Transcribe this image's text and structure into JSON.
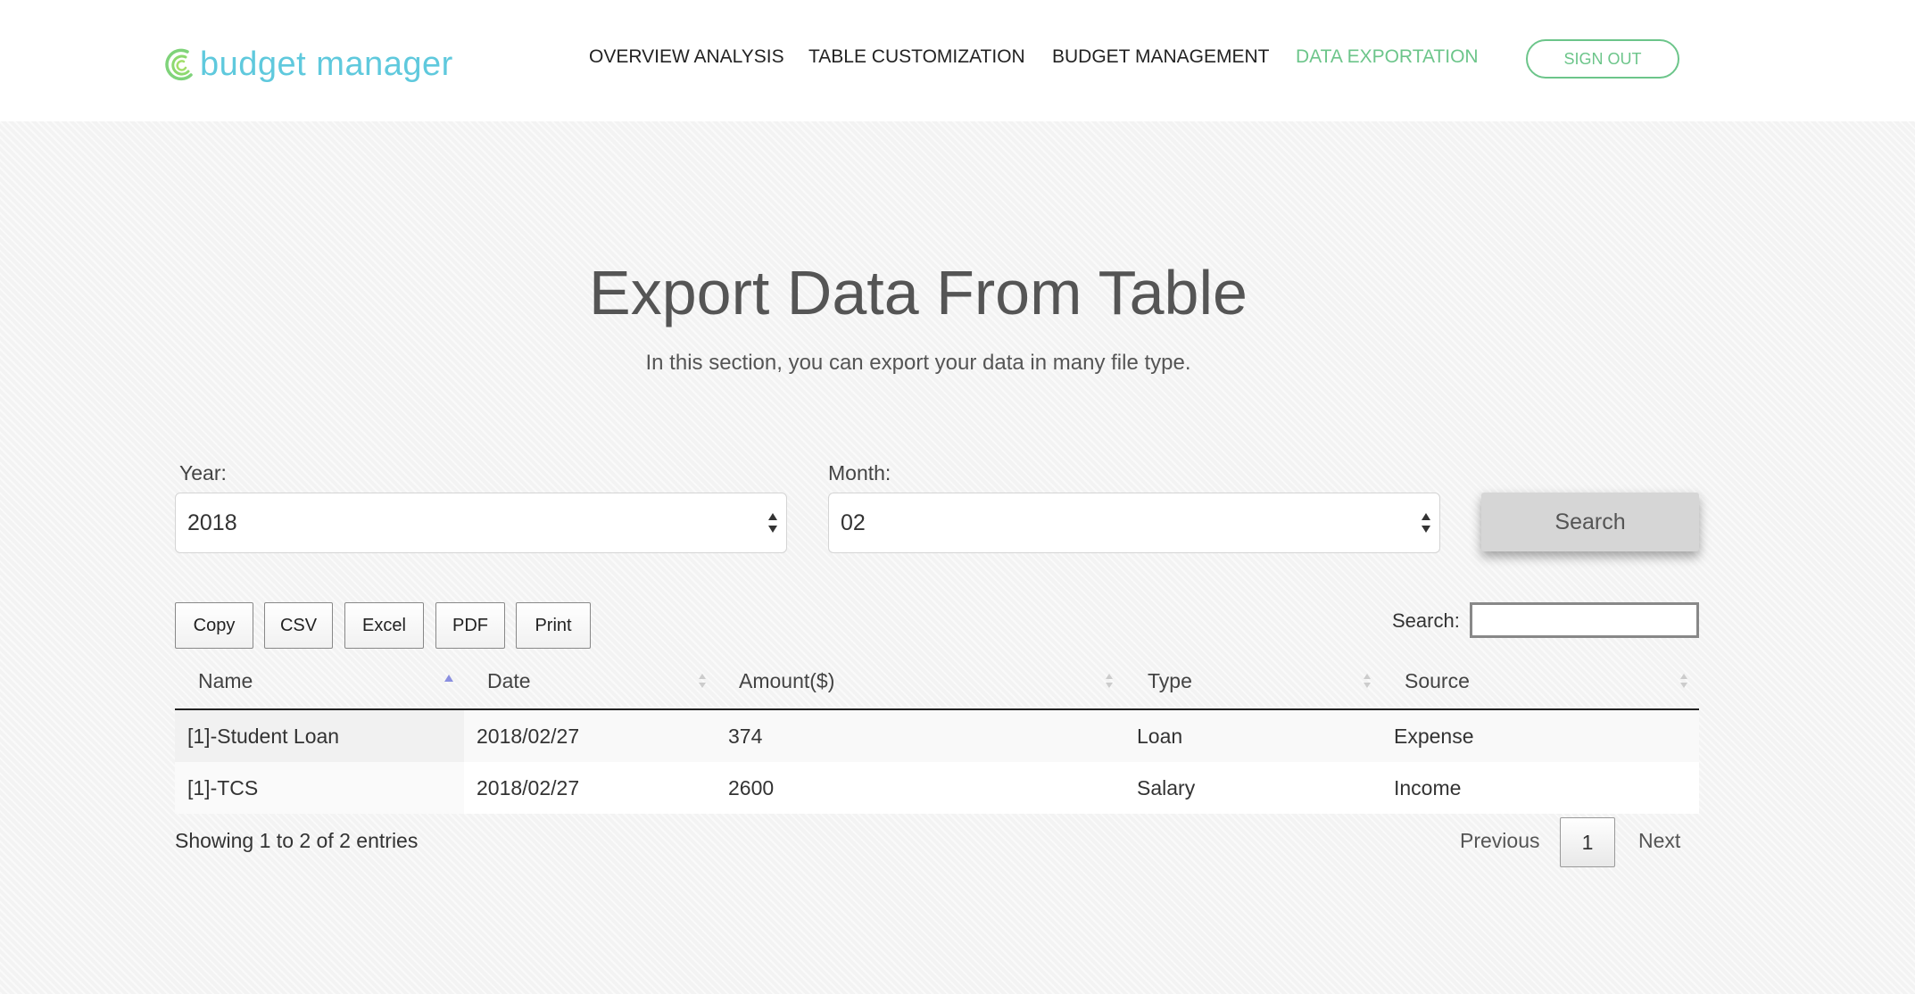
{
  "brand": {
    "name": "budget manager",
    "logo_icon": "logo-swirl-icon"
  },
  "nav": {
    "items": [
      {
        "label": "OVERVIEW ANALYSIS",
        "active": false
      },
      {
        "label": "TABLE CUSTOMIZATION",
        "active": false
      },
      {
        "label": "BUDGET MANAGEMENT",
        "active": false
      },
      {
        "label": "DATA EXPORTATION",
        "active": true
      }
    ],
    "sign_out": "SIGN OUT"
  },
  "header": {
    "title": "Export Data From Table",
    "subtitle": "In this section, you can export your data in many file type."
  },
  "filters": {
    "year": {
      "label": "Year:",
      "value": "2018"
    },
    "month": {
      "label": "Month:",
      "value": "02"
    },
    "search_button": "Search"
  },
  "export_buttons": [
    "Copy",
    "CSV",
    "Excel",
    "PDF",
    "Print"
  ],
  "table_search": {
    "label": "Search:",
    "value": ""
  },
  "table": {
    "columns": [
      "Name",
      "Date",
      "Amount($)",
      "Type",
      "Source"
    ],
    "sorted_column": "Name",
    "sort_direction": "ascending",
    "rows": [
      [
        "[1]-Student Loan",
        "2018/02/27",
        "374",
        "Loan",
        "Expense"
      ],
      [
        "[1]-TCS",
        "2018/02/27",
        "2600",
        "Salary",
        "Income"
      ]
    ]
  },
  "pagination": {
    "info": "Showing 1 to 2 of 2 entries",
    "previous": "Previous",
    "current_page": "1",
    "next": "Next"
  },
  "colors": {
    "accent": "#6cc58a",
    "brand": "#5fc9dd",
    "sort_active": "#8a8fe0"
  }
}
